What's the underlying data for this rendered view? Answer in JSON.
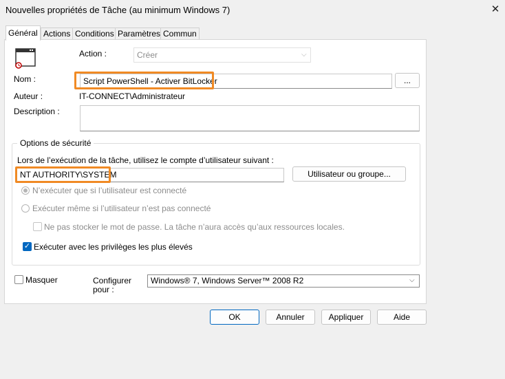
{
  "window": {
    "title": "Nouvelles propriétés de Tâche (au minimum Windows 7)",
    "close_glyph": "✕"
  },
  "tabs": [
    {
      "label": "Général",
      "active": true
    },
    {
      "label": "Actions"
    },
    {
      "label": "Conditions"
    },
    {
      "label": "Paramètres"
    },
    {
      "label": "Commun"
    }
  ],
  "general": {
    "action_label": "Action :",
    "action_value": "Créer",
    "name_label": "Nom :",
    "name_value": "Script PowerShell - Activer BitLocker",
    "browse_label": "...",
    "author_label": "Auteur :",
    "author_value": "IT-CONNECT\\Administrateur",
    "description_label": "Description :",
    "description_value": ""
  },
  "security": {
    "group_label": "Options de sécurité",
    "run_as_prompt": "Lors de l’exécution de la tâche, utilisez le compte d’utilisateur suivant :",
    "account_value": "NT AUTHORITY\\SYSTEM",
    "user_group_button": "Utilisateur ou groupe...",
    "radio_logged_on": "N’exécuter que si l’utilisateur est connecté",
    "radio_any": "Exécuter même si l’utilisateur n’est pas connecté",
    "no_store_password": "Ne pas stocker le mot de passe. La tâche n’aura accès qu’aux ressources locales.",
    "highest_privileges": "Exécuter avec les privilèges les plus élevés"
  },
  "bottom": {
    "hide_label": "Masquer",
    "configure_label_1": "Configurer",
    "configure_label_2": "pour :",
    "configure_value": "Windows® 7, Windows Server™ 2008 R2"
  },
  "buttons": {
    "ok": "OK",
    "cancel": "Annuler",
    "apply": "Appliquer",
    "help": "Aide"
  },
  "colors": {
    "highlight": "#f08a24",
    "accent": "#0067c0"
  }
}
